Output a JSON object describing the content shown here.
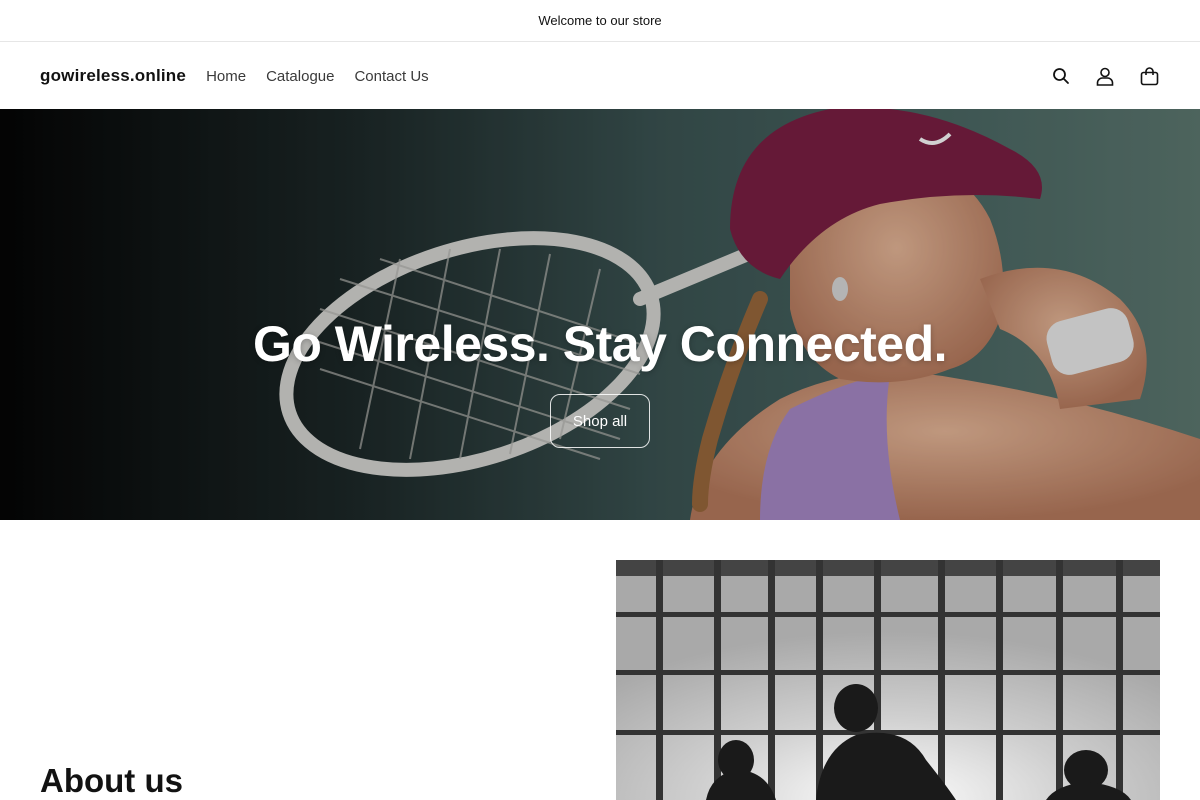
{
  "announcement": {
    "text": "Welcome to our store"
  },
  "header": {
    "logo": "gowireless.online",
    "nav": [
      "Home",
      "Catalogue",
      "Contact Us"
    ],
    "icons": [
      "search-icon",
      "account-icon",
      "cart-icon"
    ]
  },
  "hero": {
    "title": "Go Wireless. Stay Connected.",
    "button_label": "Shop all"
  },
  "about": {
    "title": "About us"
  },
  "colors": {
    "text": "#121212",
    "announcement_border": "#e6e6e6",
    "hero_text": "#ffffff"
  }
}
